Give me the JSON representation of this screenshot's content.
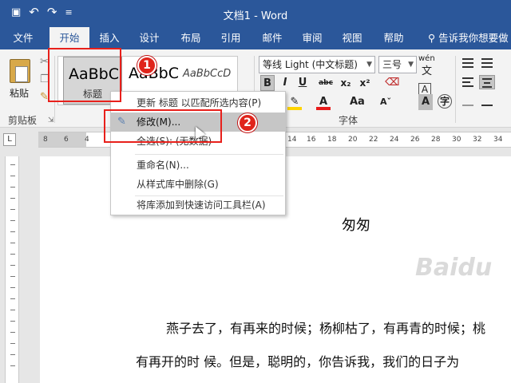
{
  "window": {
    "title": "文档1 - Word"
  },
  "quick_access": [
    {
      "icon": "save-icon",
      "glyph": "💾"
    },
    {
      "icon": "undo-icon",
      "glyph": "↶"
    },
    {
      "icon": "redo-icon",
      "glyph": "↷"
    },
    {
      "icon": "customize-qat-icon",
      "glyph": "≡"
    }
  ],
  "tabs": [
    {
      "label": "文件",
      "active": false
    },
    {
      "label": "开始",
      "active": true
    },
    {
      "label": "插入",
      "active": false
    },
    {
      "label": "设计",
      "active": false
    },
    {
      "label": "布局",
      "active": false
    },
    {
      "label": "引用",
      "active": false
    },
    {
      "label": "邮件",
      "active": false
    },
    {
      "label": "审阅",
      "active": false
    },
    {
      "label": "视图",
      "active": false
    },
    {
      "label": "帮助",
      "active": false
    }
  ],
  "tell_me": {
    "label": "告诉我你想要做"
  },
  "ribbon": {
    "paste_label": "粘贴",
    "clipboard_group": "剪贴板",
    "font_group": "字体",
    "styles": [
      {
        "sample": "AaBbC",
        "caption": "标题",
        "selected": true
      },
      {
        "sample": "AaBbC",
        "caption": "",
        "selected": false
      },
      {
        "sample": "AaBbCcD",
        "caption": "",
        "selected": false
      }
    ],
    "font_name": "等线 Light (中文标题)",
    "font_size": "三号",
    "wen_label": "wén",
    "format_buttons": [
      "B",
      "I",
      "U",
      "abc",
      "x₂",
      "x²"
    ],
    "colors": {
      "highlight": "#ffd400",
      "font_red": "#e81b1b",
      "accent": "#2b579a"
    }
  },
  "ruler": {
    "numbers": [
      "8",
      "6",
      "4",
      "14",
      "16",
      "18",
      "20",
      "22",
      "24",
      "26",
      "28",
      "30",
      "32",
      "34"
    ]
  },
  "context_menu": {
    "items": [
      {
        "label": "更新 标题 以匹配所选内容(P)",
        "highlighted": false,
        "icon": ""
      },
      {
        "label": "修改(M)...",
        "highlighted": true,
        "icon": "modify-style-icon"
      },
      {
        "label": "全选(S): (无数据)",
        "highlighted": false,
        "icon": ""
      },
      {
        "label": "重命名(N)...",
        "highlighted": false,
        "icon": ""
      },
      {
        "label": "从样式库中删除(G)",
        "highlighted": false,
        "icon": ""
      },
      {
        "label": "将库添加到快速访问工具栏(A)",
        "highlighted": false,
        "icon": ""
      }
    ]
  },
  "document": {
    "heading": "匆匆",
    "lines": [
      "燕子去了，有再来的时候；杨柳枯了，有再青的时候；桃",
      "有再开的时 候。但是，聪明的，你告诉我，我们的日子为"
    ]
  },
  "annotations": [
    {
      "label": "1"
    },
    {
      "label": "2"
    }
  ],
  "watermark": "Baidu"
}
